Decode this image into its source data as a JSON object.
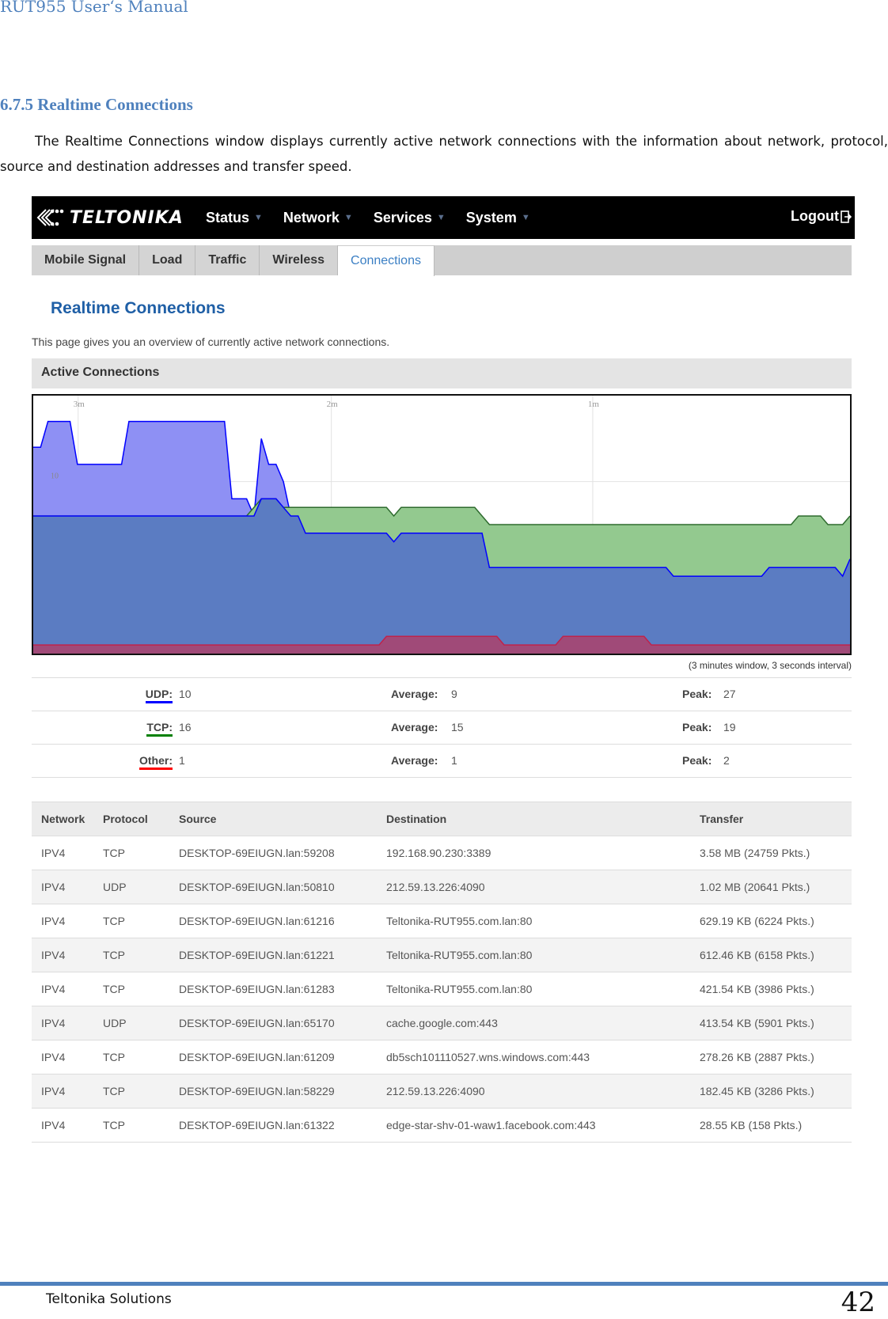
{
  "document": {
    "header": "RUT955 User‘s Manual",
    "section_number": "6.7.5",
    "section_title": "Realtime Connections",
    "intro": "The Realtime Connections window displays currently active network connections with the information about network, protocol, source and destination addresses and transfer speed.",
    "footer_company": "Teltonika Solutions",
    "page_number": "42"
  },
  "app": {
    "logo": "TELTONIKA",
    "menu": [
      {
        "label": "Status"
      },
      {
        "label": "Network"
      },
      {
        "label": "Services"
      },
      {
        "label": "System"
      }
    ],
    "logout": "Logout",
    "tabs": [
      {
        "label": "Mobile Signal",
        "active": false
      },
      {
        "label": "Load",
        "active": false
      },
      {
        "label": "Traffic",
        "active": false
      },
      {
        "label": "Wireless",
        "active": false
      },
      {
        "label": "Connections",
        "active": true
      }
    ],
    "page_title": "Realtime Connections",
    "page_description": "This page gives you an overview of currently active network connections.",
    "section_header": "Active Connections",
    "graph_note": "(3 minutes window, 3 seconds interval)",
    "colors": {
      "udp": "#0000ff",
      "tcp": "#008000",
      "other": "#ff0000",
      "udp_fill": "#8e90f4",
      "tcp_fill": "#93c98f",
      "tcp_over_udp_fill": "#5b7cc2",
      "other_fill": "#a04a78",
      "accent": "#1f5fa6"
    },
    "stats": [
      {
        "name": "UDP:",
        "value": "10",
        "average_label": "Average:",
        "average": "9",
        "peak_label": "Peak:",
        "peak": "27",
        "color": "#0000ff"
      },
      {
        "name": "TCP:",
        "value": "16",
        "average_label": "Average:",
        "average": "15",
        "peak_label": "Peak:",
        "peak": "19",
        "color": "#008000"
      },
      {
        "name": "Other:",
        "value": "1",
        "average_label": "Average:",
        "average": "1",
        "peak_label": "Peak:",
        "peak": "2",
        "color": "#ff0000"
      }
    ],
    "table": {
      "headers": [
        "Network",
        "Protocol",
        "Source",
        "Destination",
        "Transfer"
      ],
      "rows": [
        [
          "IPV4",
          "TCP",
          "DESKTOP-69EIUGN.lan:59208",
          "192.168.90.230:3389",
          "3.58 MB (24759 Pkts.)"
        ],
        [
          "IPV4",
          "UDP",
          "DESKTOP-69EIUGN.lan:50810",
          "212.59.13.226:4090",
          "1.02 MB (20641 Pkts.)"
        ],
        [
          "IPV4",
          "TCP",
          "DESKTOP-69EIUGN.lan:61216",
          "Teltonika-RUT955.com.lan:80",
          "629.19 KB (6224 Pkts.)"
        ],
        [
          "IPV4",
          "TCP",
          "DESKTOP-69EIUGN.lan:61221",
          "Teltonika-RUT955.com.lan:80",
          "612.46 KB (6158 Pkts.)"
        ],
        [
          "IPV4",
          "TCP",
          "DESKTOP-69EIUGN.lan:61283",
          "Teltonika-RUT955.com.lan:80",
          "421.54 KB (3986 Pkts.)"
        ],
        [
          "IPV4",
          "UDP",
          "DESKTOP-69EIUGN.lan:65170",
          "cache.google.com:443",
          "413.54 KB (5901 Pkts.)"
        ],
        [
          "IPV4",
          "TCP",
          "DESKTOP-69EIUGN.lan:61209",
          "db5sch101110527.wns.windows.com:443",
          "278.26 KB (2887 Pkts.)"
        ],
        [
          "IPV4",
          "TCP",
          "DESKTOP-69EIUGN.lan:58229",
          "212.59.13.226:4090",
          "182.45 KB (3286 Pkts.)"
        ],
        [
          "IPV4",
          "TCP",
          "DESKTOP-69EIUGN.lan:61322",
          "edge-star-shv-01-waw1.facebook.com:443",
          "28.55 KB (158 Pkts.)"
        ]
      ]
    }
  },
  "chart_data": {
    "type": "area",
    "title": "Active Connections",
    "xlabel": "",
    "ylabel": "",
    "x_tick_labels": [
      "3m",
      "2m",
      "1m"
    ],
    "y_tick_labels": [
      "10"
    ],
    "ylim": [
      0,
      30
    ],
    "grid": true,
    "legend": "none",
    "note": "(3 minutes window, 3 seconds interval)",
    "series": [
      {
        "name": "UDP",
        "values": [
          24,
          24,
          27,
          27,
          27,
          27,
          22,
          22,
          22,
          22,
          22,
          22,
          22,
          27,
          27,
          27,
          27,
          27,
          27,
          27,
          27,
          27,
          27,
          27,
          27,
          27,
          27,
          18,
          18,
          18,
          16,
          25,
          22,
          22,
          20,
          16,
          16,
          14,
          14,
          14,
          14,
          14,
          14,
          14,
          14,
          14,
          14,
          14,
          14,
          13,
          14,
          14,
          14,
          14,
          14,
          14,
          14,
          14,
          14,
          14,
          14,
          14,
          10,
          10,
          10,
          10,
          10,
          10,
          10,
          10,
          10,
          10,
          10,
          10,
          10,
          10,
          10,
          10,
          10,
          10,
          10,
          10,
          10,
          10,
          10,
          10,
          10,
          9,
          9,
          9,
          9,
          9,
          9,
          9,
          9,
          9,
          9,
          9,
          9,
          9,
          10,
          10,
          10,
          10,
          10,
          10,
          10,
          10,
          10,
          10,
          9,
          11
        ]
      },
      {
        "name": "TCP",
        "values": [
          16,
          16,
          16,
          16,
          16,
          16,
          16,
          16,
          16,
          16,
          16,
          16,
          16,
          16,
          16,
          16,
          16,
          16,
          16,
          16,
          16,
          16,
          16,
          16,
          16,
          16,
          16,
          16,
          16,
          16,
          17,
          18,
          18,
          18,
          17,
          17,
          17,
          17,
          17,
          17,
          17,
          17,
          17,
          17,
          17,
          17,
          17,
          17,
          17,
          16,
          17,
          17,
          17,
          17,
          17,
          17,
          17,
          17,
          17,
          17,
          17,
          16,
          15,
          15,
          15,
          15,
          15,
          15,
          15,
          15,
          15,
          15,
          15,
          15,
          15,
          15,
          15,
          15,
          15,
          15,
          15,
          15,
          15,
          15,
          15,
          15,
          15,
          15,
          15,
          15,
          15,
          15,
          15,
          15,
          15,
          15,
          15,
          15,
          15,
          15,
          15,
          15,
          15,
          15,
          16,
          16,
          16,
          16,
          15,
          15,
          15,
          16
        ]
      },
      {
        "name": "Other",
        "values": [
          1,
          1,
          1,
          1,
          1,
          1,
          1,
          1,
          1,
          1,
          1,
          1,
          1,
          1,
          1,
          1,
          1,
          1,
          1,
          1,
          1,
          1,
          1,
          1,
          1,
          1,
          1,
          1,
          1,
          1,
          1,
          1,
          1,
          1,
          1,
          1,
          1,
          1,
          1,
          1,
          1,
          1,
          1,
          1,
          1,
          1,
          1,
          1,
          2,
          2,
          2,
          2,
          2,
          2,
          2,
          2,
          2,
          2,
          2,
          2,
          2,
          2,
          2,
          2,
          1,
          1,
          1,
          1,
          1,
          1,
          1,
          1,
          2,
          2,
          2,
          2,
          2,
          2,
          2,
          2,
          2,
          2,
          2,
          2,
          1,
          1,
          1,
          1,
          1,
          1,
          1,
          1,
          1,
          1,
          1,
          1,
          1,
          1,
          1,
          1,
          1,
          1,
          1,
          1,
          1,
          1,
          1,
          1,
          1,
          1,
          1,
          1
        ]
      }
    ]
  }
}
